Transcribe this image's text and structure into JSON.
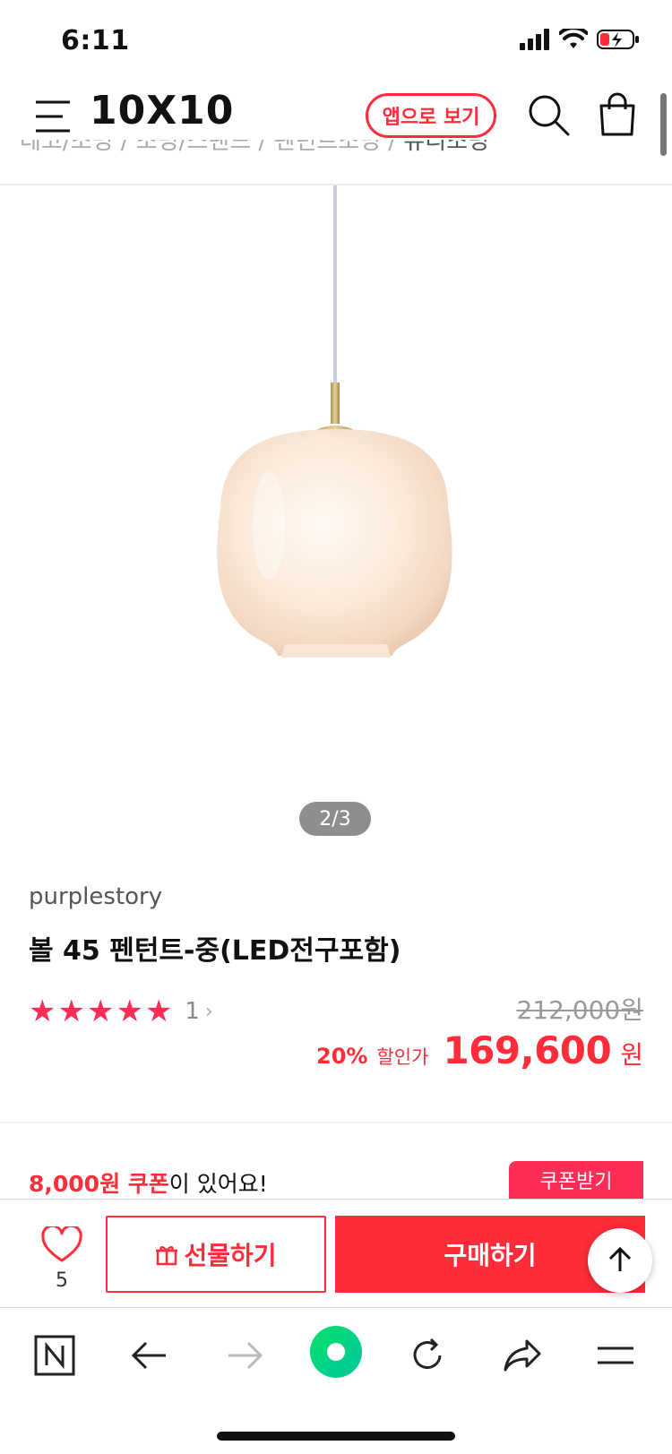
{
  "status_bar": {
    "time": "6:11"
  },
  "header": {
    "logo": "10X10",
    "app_button_label": "앱으로 보기"
  },
  "breadcrumb": {
    "items": [
      "데코/조명",
      "조명/스탠드",
      "펜던트조명",
      "유리조명"
    ]
  },
  "product": {
    "pager": "2/3",
    "brand": "purplestory",
    "title": "볼 45 펜턴트-중(LED전구포함)",
    "rating_stars": 5,
    "review_count": "1",
    "original_price": "212,000원",
    "discount_percent": "20%",
    "discount_label": "할인가",
    "sale_price": "169,600",
    "sale_currency": "원"
  },
  "coupon": {
    "amount_text": "8,000원 쿠폰",
    "suffix_text": "이 있어요!",
    "button_label": "쿠폰받기"
  },
  "action_bar": {
    "wish_count": "5",
    "gift_label": "선물하기",
    "buy_label": "구매하기"
  },
  "colors": {
    "accent_red": "#ff2c39",
    "star_pink": "#ff2c55",
    "naver_green": "#03c75a"
  },
  "icons": [
    "menu-icon",
    "search-icon",
    "shopping-bag-icon",
    "heart-icon",
    "gift-icon",
    "arrow-up-icon",
    "naver-n-icon",
    "back-arrow-icon",
    "forward-arrow-icon",
    "green-dot-icon",
    "refresh-icon",
    "share-icon",
    "hamburger-icon"
  ]
}
